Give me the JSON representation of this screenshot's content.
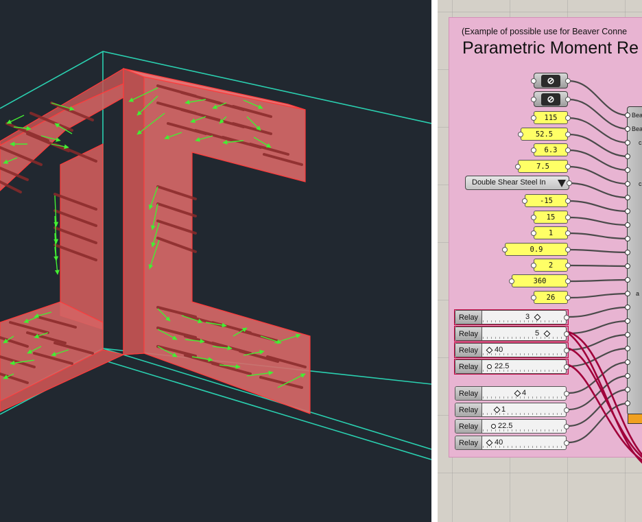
{
  "group": {
    "caption": "(Example of possible use for Beaver Conne",
    "title": "Parametric Moment Re"
  },
  "params": [
    {
      "icon": "bolt-param-icon",
      "glyph": "⊘"
    },
    {
      "icon": "bolt-param-icon",
      "glyph": "⊘"
    }
  ],
  "panels": [
    "115",
    "52.5",
    "6.3",
    "7.5",
    "-15",
    "15",
    "1",
    "0.9",
    "2",
    "360",
    "26"
  ],
  "value_list": {
    "selected": "Double Shear Steel In"
  },
  "sliders": [
    {
      "label": "Relay",
      "value": "3"
    },
    {
      "label": "Relay",
      "value": "5"
    },
    {
      "label": "Relay",
      "value": "40"
    },
    {
      "label": "Relay",
      "value": "22.5"
    },
    {
      "label": "Relay",
      "value": "4"
    },
    {
      "label": "Relay",
      "value": "1"
    },
    {
      "label": "Relay",
      "value": "22.5"
    },
    {
      "label": "Relay",
      "value": "40"
    }
  ],
  "component": {
    "inputs": [
      "Bea",
      "Bea",
      "c",
      "c",
      "a"
    ]
  },
  "colors": {
    "viewport_bg": "#212830",
    "beam": "#e06060",
    "bounding_box": "#2ad0b0",
    "arrows": "#44ee33",
    "group": "#e8b4d2",
    "panel": "#ffff66",
    "wire": "#4a4a4a",
    "selected_wire": "#a0003a",
    "output": "#f0a020"
  }
}
